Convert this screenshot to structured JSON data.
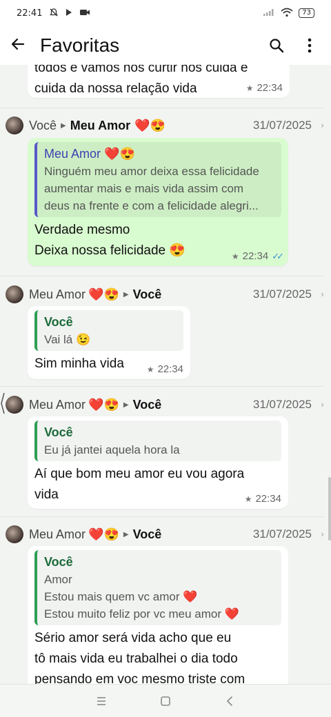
{
  "status_bar": {
    "time": "22:41",
    "battery": "73"
  },
  "app_bar": {
    "title": "Favoritas"
  },
  "messages": [
    {
      "partial": true,
      "text_lines": [
        "todos e vamos nos curtir nos cuida e",
        "cuida da nossa relação vida"
      ],
      "time": "22:34"
    },
    {
      "from": "Você",
      "to": "Meu Amor",
      "to_emoji": "❤️😍",
      "date": "31/07/2025",
      "quote_author": "Meu Amor",
      "quote_author_emoji": "❤️😍",
      "quote_lines": [
        "Ninguém meu amor deixa essa felicidade",
        "aumentar mais e mais vida assim com",
        "deus na frente e com a felicidade alegri..."
      ],
      "text_lines": [
        "Verdade mesmo",
        "Deixa nossa felicidade 😍"
      ],
      "time": "22:34"
    },
    {
      "from": "Meu Amor",
      "from_emoji": "❤️😍",
      "to": "Você",
      "date": "31/07/2025",
      "quote_author": "Você",
      "quote_lines": [
        "Vai lá 😉"
      ],
      "text_lines": [
        "Sim minha vida"
      ],
      "time": "22:34"
    },
    {
      "from": "Meu Amor",
      "from_emoji": "❤️😍",
      "to": "Você",
      "date": "31/07/2025",
      "quote_author": "Você",
      "quote_lines": [
        "Eu já jantei aquela hora la"
      ],
      "text_lines": [
        "Aí que bom meu amor eu vou agora",
        "vida"
      ],
      "time": "22:34"
    },
    {
      "from": "Meu Amor",
      "from_emoji": "❤️😍",
      "to": "Você",
      "date": "31/07/2025",
      "quote_author": "Você",
      "quote_lines": [
        "Amor",
        "Estou mais quem vc amor ❤️",
        "Estou muito feliz por vc meu amor ❤️"
      ],
      "text_lines": [
        "Sério amor será vida acho que eu",
        "tô mais vida eu trabalhei o dia todo",
        "pensando em voc mesmo triste com"
      ]
    }
  ],
  "icons": {
    "status": [
      "muted-bell-icon",
      "play-icon",
      "video-icon",
      "signal-icon",
      "wifi-icon",
      "battery-icon"
    ],
    "app_bar": [
      "back-arrow-icon",
      "search-icon",
      "more-vert-icon"
    ],
    "nav": [
      "menu-icon",
      "home-icon",
      "back-icon"
    ]
  },
  "colors": {
    "outgoing_bubble": "#d9fbd0",
    "incoming_bubble": "#ffffff",
    "quote_bar": "#2e9e55",
    "read_ticks": "#3a8fd8"
  }
}
